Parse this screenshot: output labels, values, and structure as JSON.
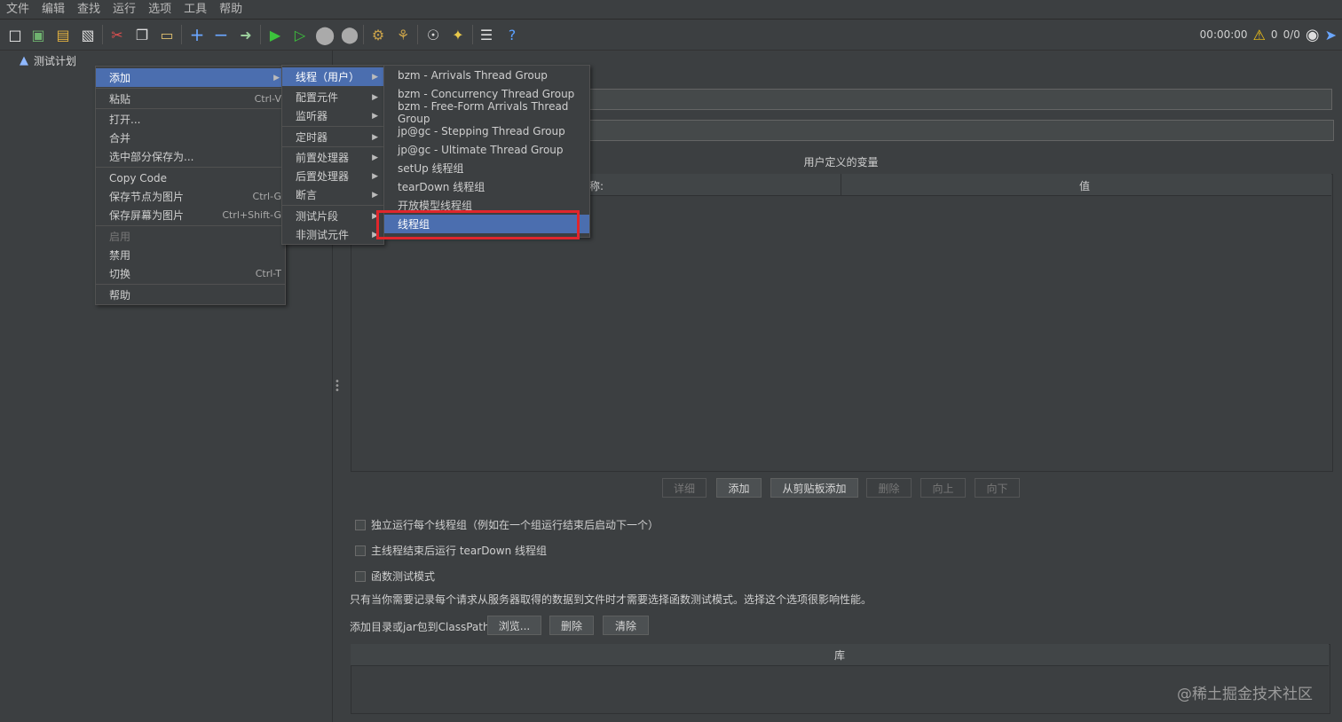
{
  "menubar": [
    "文件",
    "编辑",
    "查找",
    "运行",
    "选项",
    "工具",
    "帮助"
  ],
  "toolbar": {
    "timer": "00:00:00",
    "warn_count": "0",
    "thread_ratio": "0/0"
  },
  "tree": {
    "root_label": "测试计划"
  },
  "main": {
    "vars_title": "用户定义的变量",
    "col_name": "称:",
    "col_value": "值",
    "buttons": {
      "detail": "详细",
      "add": "添加",
      "add_clipboard": "从剪贴板添加",
      "delete": "删除",
      "up": "向上",
      "down": "向下"
    },
    "checkboxes": {
      "independent": "独立运行每个线程组（例如在一个组运行结束后启动下一个）",
      "teardown": "主线程结束后运行 tearDown 线程组",
      "functional": "函数测试模式"
    },
    "note": "只有当你需要记录每个请求从服务器取得的数据到文件时才需要选择函数测试模式。选择这个选项很影响性能。",
    "classpath_label": "添加目录或jar包到ClassPath",
    "classpath_buttons": {
      "browse": "浏览...",
      "delete": "删除",
      "clear": "清除"
    },
    "lib_header": "库",
    "watermark": "@稀土掘金技术社区"
  },
  "context_menu": {
    "add": "添加",
    "paste": "粘贴",
    "paste_acc": "Ctrl-V",
    "open": "打开...",
    "merge": "合并",
    "save_selection": "选中部分保存为...",
    "copy_code": "Copy Code",
    "save_node_img": "保存节点为图片",
    "save_node_img_acc": "Ctrl-G",
    "save_screen_img": "保存屏幕为图片",
    "save_screen_img_acc": "Ctrl+Shift-G",
    "enable": "启用",
    "disable": "禁用",
    "toggle": "切换",
    "toggle_acc": "Ctrl-T",
    "help": "帮助"
  },
  "add_submenu": [
    "线程（用户）",
    "配置元件",
    "监听器",
    "定时器",
    "前置处理器",
    "后置处理器",
    "断言",
    "测试片段",
    "非测试元件"
  ],
  "threads_submenu": [
    "bzm - Arrivals Thread Group",
    "bzm - Concurrency Thread Group",
    "bzm - Free-Form Arrivals Thread Group",
    "jp@gc - Stepping Thread Group",
    "jp@gc - Ultimate Thread Group",
    "setUp 线程组",
    "tearDown 线程组",
    "开放模型线程组",
    "线程组"
  ],
  "colors": {
    "selection": "#4b6eaf",
    "highlight_box": "#e0262c",
    "background": "#3c3f41"
  }
}
